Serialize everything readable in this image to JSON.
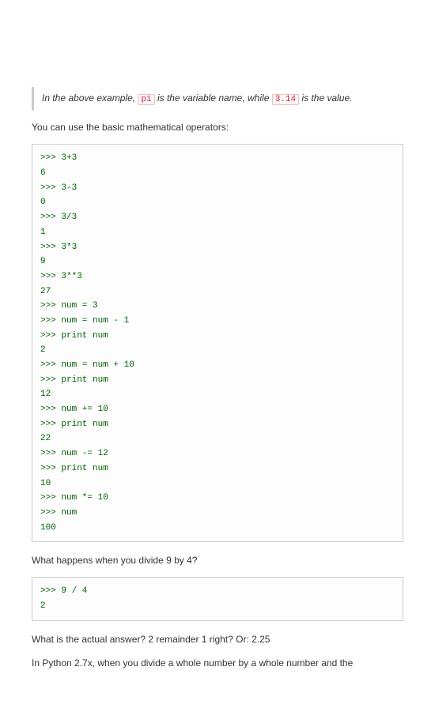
{
  "note": {
    "prefix": "In the above example, ",
    "code1": "pi",
    "mid": " is the variable name, while ",
    "code2": "3.14",
    "suffix": " is the value."
  },
  "para1": "You can use the basic mathematical operators:",
  "codeblock1": ">>> 3+3\n6\n>>> 3-3\n0\n>>> 3/3\n1\n>>> 3*3\n9\n>>> 3**3\n27\n>>> num = 3\n>>> num = num - 1\n>>> print num\n2\n>>> num = num + 10\n>>> print num\n12\n>>> num += 10\n>>> print num\n22\n>>> num -= 12\n>>> print num\n10\n>>> num *= 10\n>>> num\n100",
  "para2": "What happens when you divide 9 by 4?",
  "codeblock2": ">>> 9 / 4\n2",
  "para3": "What is the actual answer? 2 remainder 1 right? Or: 2.25",
  "para4": "In Python 2.7x, when you divide a whole number by a whole number and the"
}
